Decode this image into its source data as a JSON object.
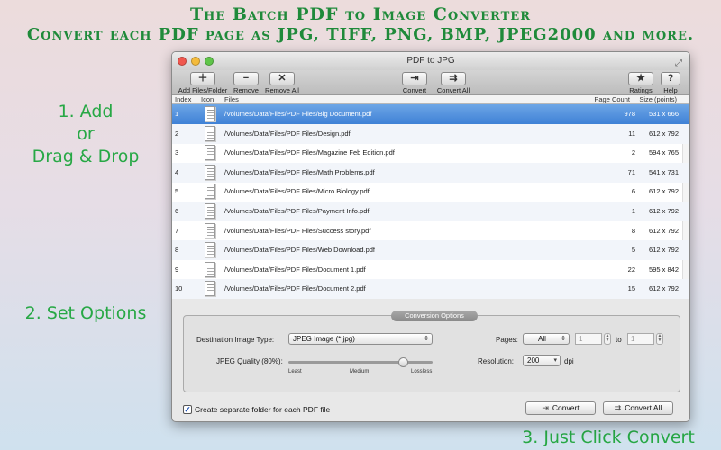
{
  "headline": {
    "line1": "The Batch PDF to Image Converter",
    "line2": "Convert each PDF page as JPG, TIFF, PNG, BMP, JPEG2000 and more."
  },
  "steps": {
    "add_line1": "1. Add",
    "add_line2": "or",
    "add_line3": "Drag & Drop",
    "options": "2. Set Options",
    "convert": "3. Just Click Convert"
  },
  "window": {
    "title": "PDF to JPG"
  },
  "toolbar": {
    "add_label": "Add Files/Folder",
    "remove_label": "Remove",
    "remove_all_label": "Remove All",
    "convert_label": "Convert",
    "convert_all_label": "Convert All",
    "ratings_label": "Ratings",
    "help_label": "Help"
  },
  "table": {
    "columns": {
      "index": "Index",
      "icon": "Icon",
      "files": "Files",
      "page_count": "Page Count",
      "size": "Size (points)"
    },
    "rows": [
      {
        "index": "1",
        "file": "/Volumes/Data/Files/PDF Files/Big Document.pdf",
        "pages": "978",
        "size": "531 x 666"
      },
      {
        "index": "2",
        "file": "/Volumes/Data/Files/PDF Files/Design.pdf",
        "pages": "11",
        "size": "612 x 792"
      },
      {
        "index": "3",
        "file": "/Volumes/Data/Files/PDF Files/Magazine Feb Edition.pdf",
        "pages": "2",
        "size": "594 x 765"
      },
      {
        "index": "4",
        "file": "/Volumes/Data/Files/PDF Files/Math Problems.pdf",
        "pages": "71",
        "size": "541 x 731"
      },
      {
        "index": "5",
        "file": "/Volumes/Data/Files/PDF Files/Micro Biology.pdf",
        "pages": "6",
        "size": "612 x 792"
      },
      {
        "index": "6",
        "file": "/Volumes/Data/Files/PDF Files/Payment Info.pdf",
        "pages": "1",
        "size": "612 x 792"
      },
      {
        "index": "7",
        "file": "/Volumes/Data/Files/PDF Files/Success story.pdf",
        "pages": "8",
        "size": "612 x 792"
      },
      {
        "index": "8",
        "file": "/Volumes/Data/Files/PDF Files/Web Download.pdf",
        "pages": "5",
        "size": "612 x 792"
      },
      {
        "index": "9",
        "file": "/Volumes/Data/Files/PDF Files/Document 1.pdf",
        "pages": "22",
        "size": "595 x 842"
      },
      {
        "index": "10",
        "file": "/Volumes/Data/Files/PDF Files/Document 2.pdf",
        "pages": "15",
        "size": "612 x 792"
      }
    ],
    "selected_index": "1"
  },
  "options": {
    "title": "Conversion Options",
    "dest_type_label": "Destination Image Type:",
    "dest_type_value": "JPEG Image (*.jpg)",
    "quality_label": "JPEG Quality (80%):",
    "quality_value": 0.8,
    "slider_least": "Least",
    "slider_medium": "Medium",
    "slider_lossless": "Lossless",
    "pages_label": "Pages:",
    "pages_value": "All",
    "page_from": "1",
    "page_to_label": "to",
    "page_to": "1",
    "resolution_label": "Resolution:",
    "resolution_value": "200",
    "resolution_unit": "dpi"
  },
  "bottom": {
    "separate_folder_label": "Create separate folder for each PDF file",
    "separate_folder_checked": true,
    "convert_label": "Convert",
    "convert_all_label": "Convert All"
  },
  "colors": {
    "headline_green": "#1f8a3a",
    "step_green": "#27a845",
    "selection_blue": "#3f81d6"
  },
  "icons": {
    "add": "plus-icon",
    "remove": "minus-icon",
    "remove_all": "x-icon",
    "convert": "convert-arrow-icon",
    "ratings": "star-icon",
    "help": "question-icon"
  }
}
